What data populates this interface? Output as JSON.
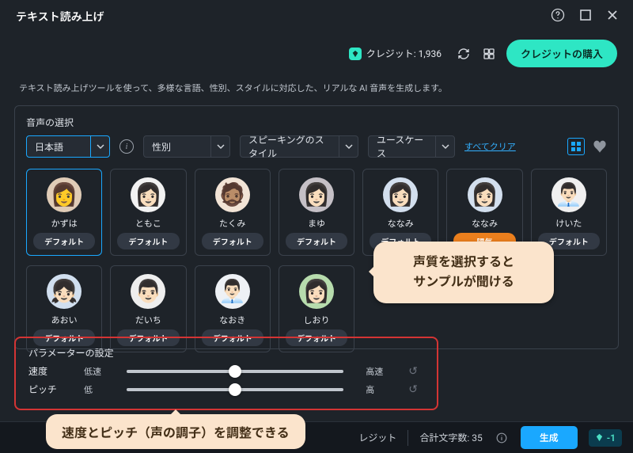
{
  "titlebar": {
    "title": "テキスト読み上げ"
  },
  "top": {
    "credits_label": "クレジット: 1,936",
    "buy_label": "クレジットの購入"
  },
  "description": "テキスト読み上げツールを使って、多様な言語、性別、スタイルに対応した、リアルな AI 音声を生成します。",
  "panel": {
    "title": "音声の選択",
    "language_value": "日本語",
    "gender_label": "性別",
    "style_label": "スピーキングのスタイル",
    "usecase_label": "ユースケース",
    "clear_all": "すべてクリア"
  },
  "voices": [
    {
      "name": "かずは",
      "badge": "デフォルト",
      "selected": true,
      "emoji": "👩",
      "bg": "#e0ccb7"
    },
    {
      "name": "ともこ",
      "badge": "デフォルト",
      "emoji": "👩🏻",
      "bg": "#f2f2f2"
    },
    {
      "name": "たくみ",
      "badge": "デフォルト",
      "emoji": "🧔🏽",
      "bg": "#f2e4d6"
    },
    {
      "name": "まゆ",
      "badge": "デフォルト",
      "emoji": "👩🏻",
      "bg": "#c5c0c6"
    },
    {
      "name": "ななみ",
      "badge": "デフォルト",
      "emoji": "👩🏻",
      "bg": "#d3dfee"
    },
    {
      "name": "ななみ",
      "badge": "陽気",
      "badge_style": "orange",
      "emoji": "👩🏻",
      "bg": "#d3dfee"
    },
    {
      "name": "けいた",
      "badge": "デフォルト",
      "emoji": "👨🏻‍💼",
      "bg": "#f0f0f0"
    },
    {
      "name": "あおい",
      "badge": "デフォルト",
      "emoji": "👧🏻",
      "bg": "#d1dfef"
    },
    {
      "name": "だいち",
      "badge": "デフォルト",
      "emoji": "👨🏻",
      "bg": "#eeeeee"
    },
    {
      "name": "なおき",
      "badge": "デフォルト",
      "emoji": "👨🏻‍💼",
      "bg": "#eef1f5"
    },
    {
      "name": "しおり",
      "badge": "デフォルト",
      "emoji": "👩🏻",
      "bg": "#b7dcad"
    }
  ],
  "callouts": {
    "sample": "声質を選択すると\nサンプルが聞ける",
    "params": "速度とピッチ（声の調子）を調整できる"
  },
  "params": {
    "title": "パラメーターの設定",
    "speed": {
      "label": "速度",
      "min": "低速",
      "max": "高速",
      "pos": 50
    },
    "pitch": {
      "label": "ピッチ",
      "min": "低",
      "max": "高",
      "pos": 50
    }
  },
  "bottom": {
    "credits_short": "レジット",
    "count_label": "合計文字数: 35",
    "generate": "生成",
    "cost": "-1"
  }
}
